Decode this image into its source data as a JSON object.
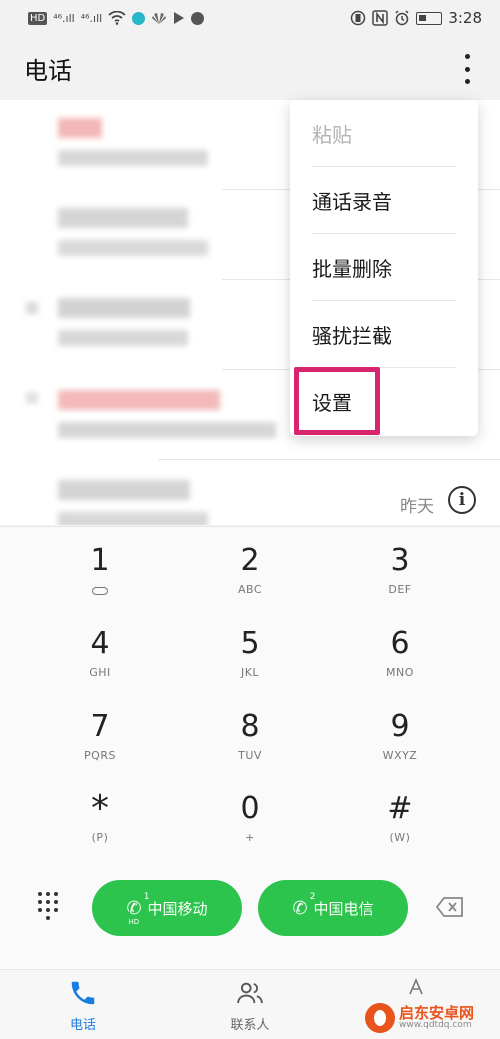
{
  "status_bar": {
    "left_chip": "HD",
    "signal1": "⁴⁶.ıll",
    "signal2": "⁴⁶.ıll",
    "time": "3:28"
  },
  "appbar": {
    "title": "电话"
  },
  "menu": {
    "items": [
      {
        "label": "粘贴",
        "disabled": true
      },
      {
        "label": "通话录音"
      },
      {
        "label": "批量删除"
      },
      {
        "label": "骚扰拦截"
      },
      {
        "label": "设置"
      }
    ]
  },
  "call_log": {
    "last_date": "昨天",
    "info_symbol": "i"
  },
  "dialpad": {
    "keys": [
      {
        "digit": "1",
        "letters": ""
      },
      {
        "digit": "2",
        "letters": "ABC"
      },
      {
        "digit": "3",
        "letters": "DEF"
      },
      {
        "digit": "4",
        "letters": "GHI"
      },
      {
        "digit": "5",
        "letters": "JKL"
      },
      {
        "digit": "6",
        "letters": "MNO"
      },
      {
        "digit": "7",
        "letters": "PQRS"
      },
      {
        "digit": "8",
        "letters": "TUV"
      },
      {
        "digit": "9",
        "letters": "WXYZ"
      },
      {
        "digit": "*",
        "letters": "(P)"
      },
      {
        "digit": "0",
        "letters": "+"
      },
      {
        "digit": "#",
        "letters": "(W)"
      }
    ],
    "call_buttons": [
      {
        "label": "中国移动",
        "sim": "1",
        "badge": "HD"
      },
      {
        "label": "中国电信",
        "sim": "2"
      }
    ]
  },
  "bottom_nav": {
    "items": [
      {
        "label": "电话",
        "active": true
      },
      {
        "label": "联系人"
      }
    ]
  },
  "watermark": {
    "title": "启东安卓网",
    "url": "www.qdtdq.com"
  },
  "colors": {
    "accent_green": "#2cc44c",
    "active_blue": "#1a7ce0",
    "highlight_pink": "#d9246e"
  }
}
